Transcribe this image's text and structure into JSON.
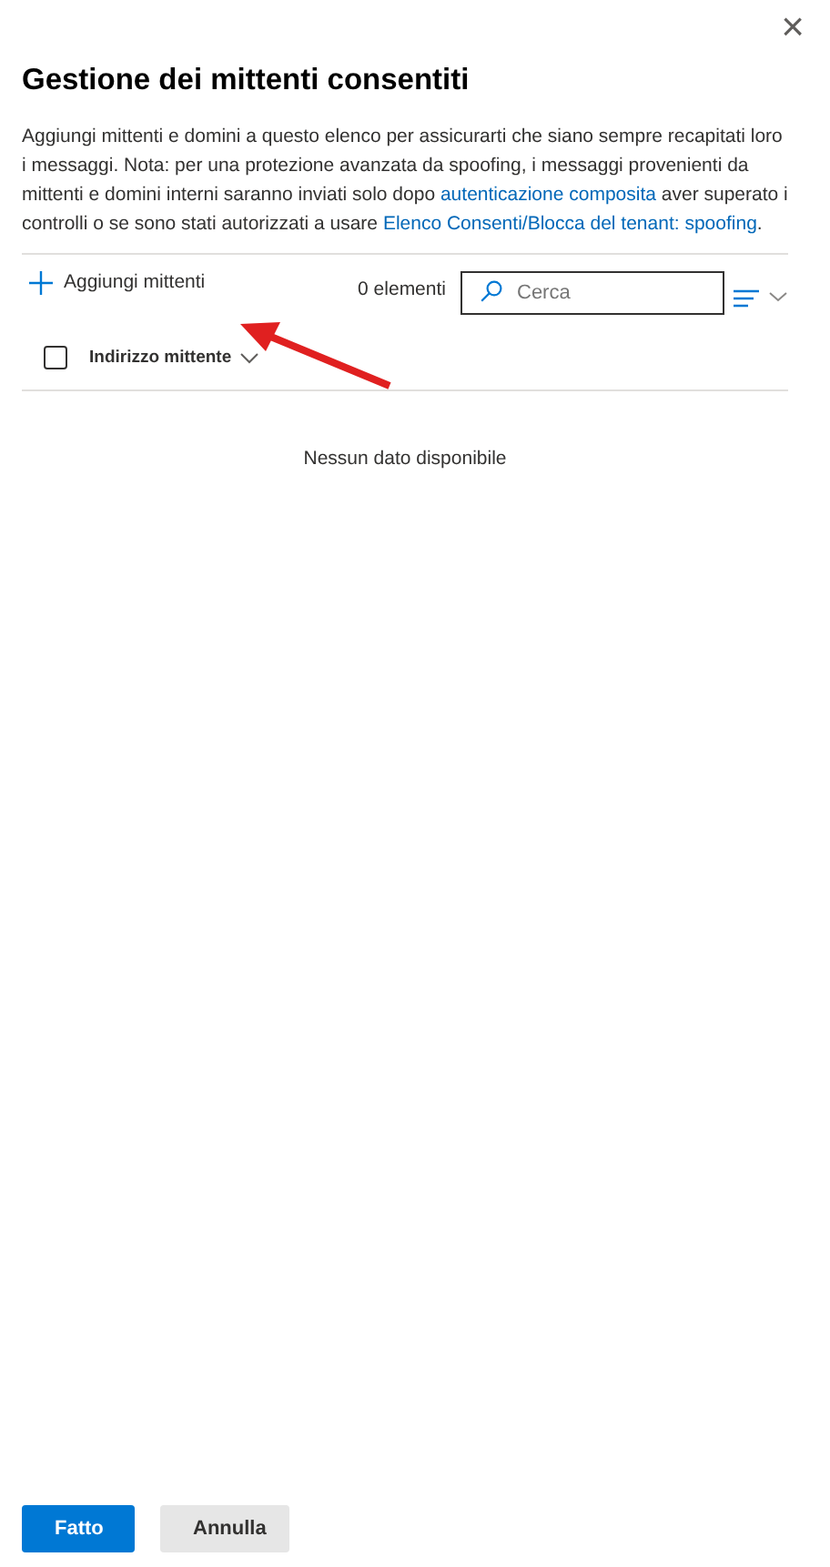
{
  "panel": {
    "title": "Gestione dei mittenti consentiti",
    "close_glyph": "×"
  },
  "description": [
    {
      "kind": "text",
      "text": "Aggiungi mittenti e domini a questo elenco per assicurarti che siano sempre recapitati loro i messaggi. Nota: per una protezione avanzata da spoofing, i messaggi provenienti da mittenti e domini interni saranno inviati solo dopo "
    },
    {
      "kind": "link",
      "text": "autenticazione composita"
    },
    {
      "kind": "text",
      "text": " aver superato i controlli o se sono stati autorizzati a usare "
    },
    {
      "kind": "link",
      "text": "Elenco Consenti/Blocca del tenant: spoofing"
    },
    {
      "kind": "text",
      "text": "."
    }
  ],
  "toolbar": {
    "add_button": "Aggiungi mittenti",
    "count": "0 elementi",
    "search": {
      "placeholder": "Cerca"
    }
  },
  "table": {
    "select_all": {
      "checked": false
    },
    "columns": [
      {
        "label": "Indirizzo mittente"
      }
    ],
    "empty_message": "Nessun dato disponibile"
  },
  "annotation": {
    "kind": "arrow"
  },
  "buttons": [
    {
      "label": "Fatto",
      "kind": "primary"
    },
    {
      "label": "Annulla",
      "kind": "secondary"
    }
  ]
}
